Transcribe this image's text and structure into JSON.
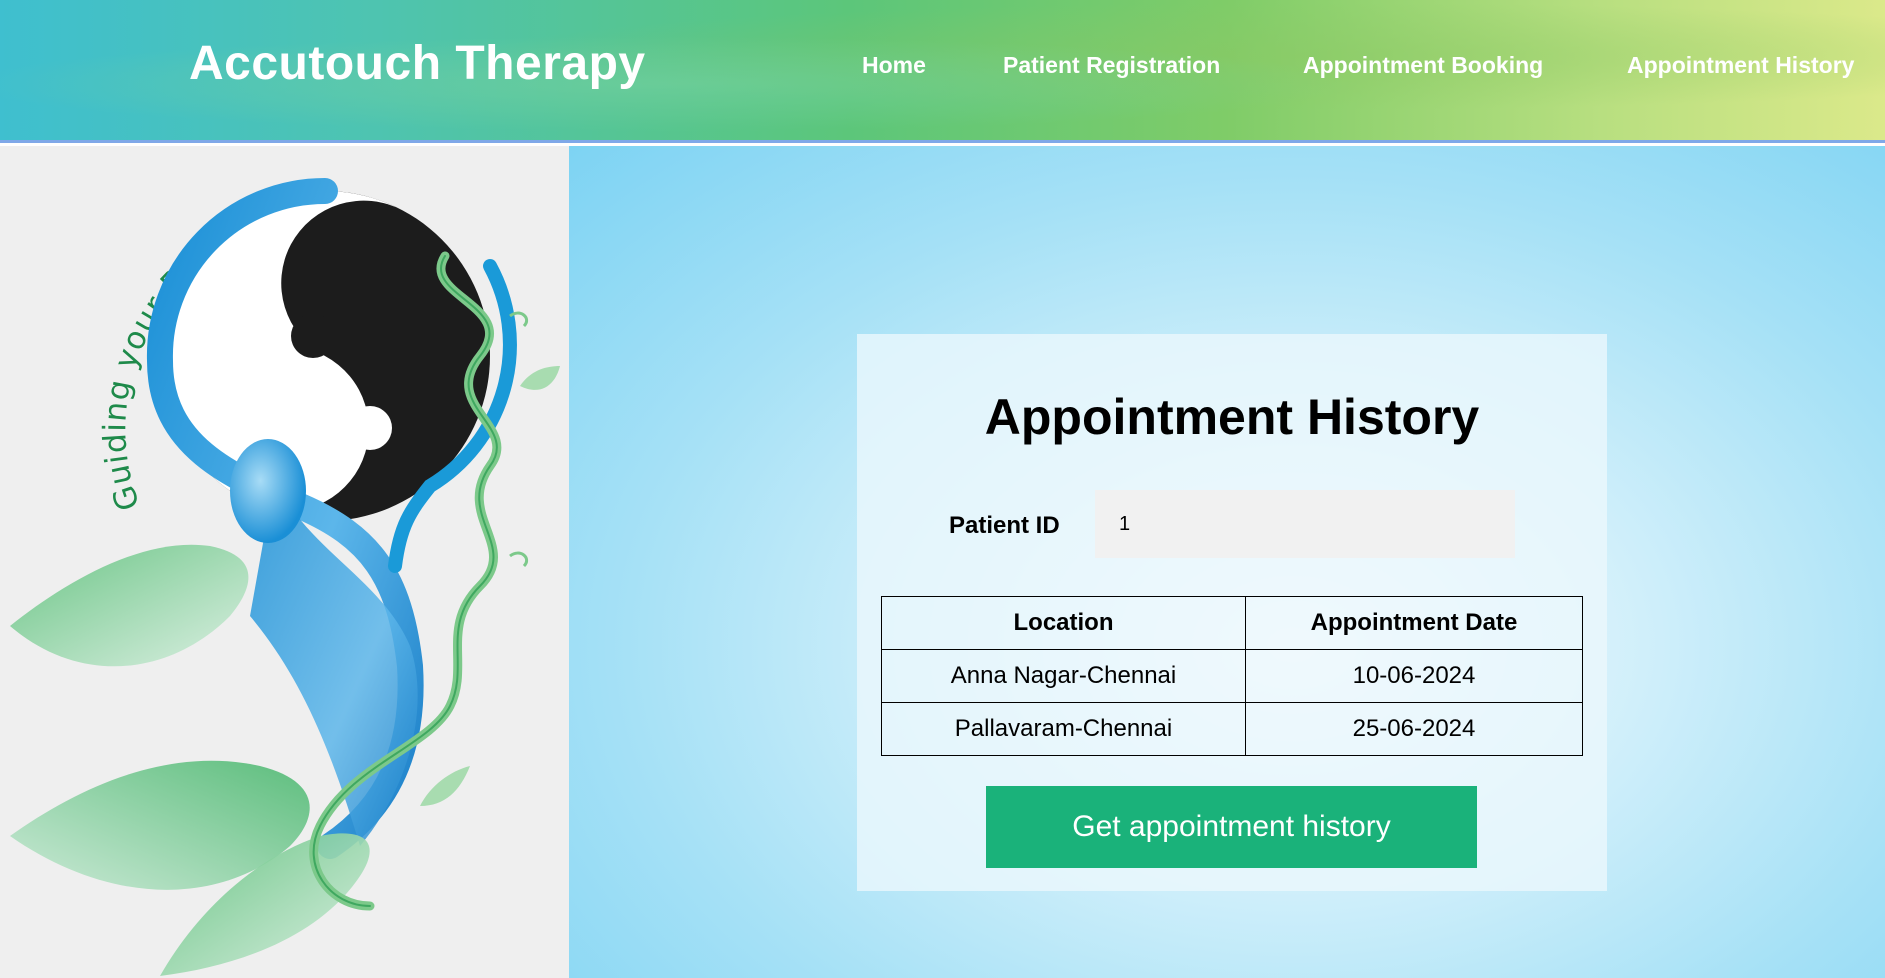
{
  "header": {
    "brand": "Accutouch Therapy",
    "nav": [
      {
        "label": "Home"
      },
      {
        "label": "Patient Registration"
      },
      {
        "label": "Appointment Booking"
      },
      {
        "label": "Appointment History"
      }
    ]
  },
  "logo": {
    "tagline": "Guiding your Body to Wellness.",
    "icon": "yin-yang-wellness-logo"
  },
  "form": {
    "title": "Appointment History",
    "patient_id_label": "Patient ID",
    "patient_id_value": "1",
    "button_label": "Get appointment history"
  },
  "table": {
    "headers": [
      "Location",
      "Appointment Date"
    ],
    "rows": [
      [
        "Anna Nagar-Chennai",
        "10-06-2024"
      ],
      [
        "Pallavaram-Chennai",
        "25-06-2024"
      ]
    ]
  },
  "colors": {
    "button": "#1ab27a",
    "header_start": "#3fbfcf",
    "header_end": "#dbe98a",
    "logo_green": "#1e8a4a",
    "logo_blue": "#1a9ad8"
  }
}
